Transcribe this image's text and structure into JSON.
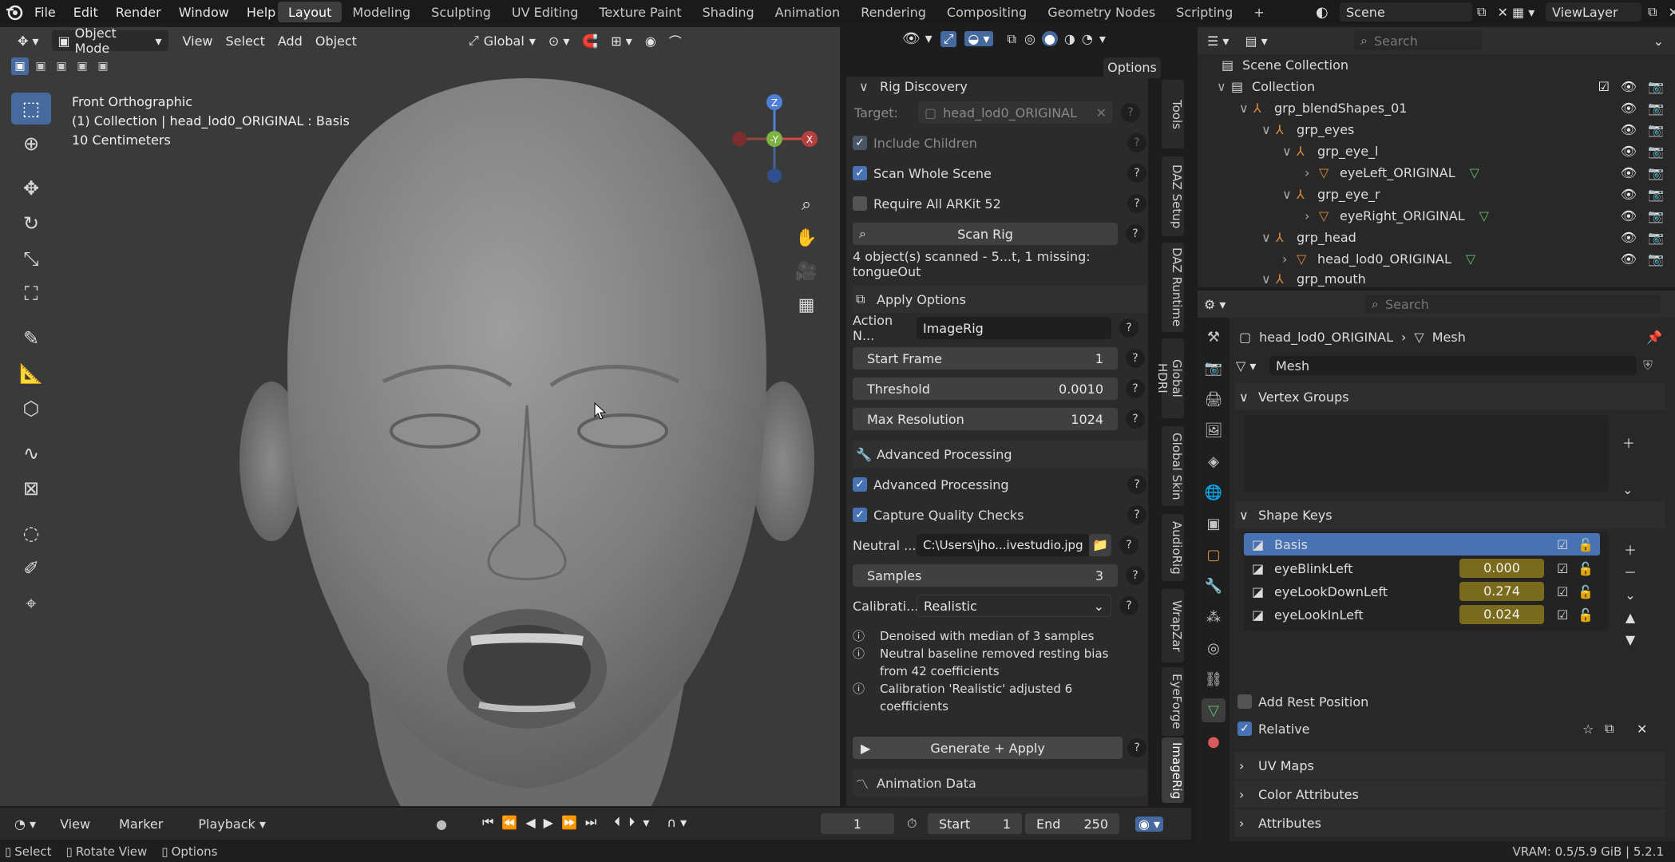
{
  "topbar": {
    "menus": [
      "File",
      "Edit",
      "Render",
      "Window",
      "Help"
    ],
    "workspaces": [
      "Layout",
      "Modeling",
      "Sculpting",
      "UV Editing",
      "Texture Paint",
      "Shading",
      "Animation",
      "Rendering",
      "Compositing",
      "Geometry Nodes",
      "Scripting"
    ],
    "active_workspace": "Layout",
    "add_tab": "+",
    "scene": "Scene",
    "view_layer": "ViewLayer"
  },
  "viewport": {
    "mode": "Object Mode",
    "menus": [
      "View",
      "Select",
      "Add",
      "Object"
    ],
    "transform": "Global",
    "options": "Options",
    "overlay_title": "Front Orthographic",
    "overlay_line2": "(1) Collection | head_lod0_ORIGINAL : Basis",
    "overlay_line3": "10 Centimeters",
    "gizmo": {
      "z": "Z",
      "y": "-Y",
      "x": "X"
    }
  },
  "npanel": {
    "rig_discovery": "Rig Discovery",
    "target_label": "Target:",
    "target_value": "head_lod0_ORIGINAL",
    "include_children": "Include Children",
    "scan_whole_scene": "Scan Whole Scene",
    "require_arkit": "Require All ARKit 52",
    "scan_rig": "Scan Rig",
    "scan_status": "4 object(s) scanned - 5...t, 1 missing: tongueOut",
    "apply_options": "Apply Options",
    "action_label": "Action N...",
    "action_value": "ImageRig",
    "start_frame_label": "Start Frame",
    "start_frame_value": "1",
    "threshold_label": "Threshold",
    "threshold_value": "0.0010",
    "max_res_label": "Max Resolution",
    "max_res_value": "1024",
    "advanced_header": "Advanced Processing",
    "advanced_processing": "Advanced Processing",
    "capture_quality": "Capture Quality Checks",
    "neutral_label": "Neutral ...",
    "neutral_value": "C:\\Users\\jho...ivestudio.jpg",
    "samples_label": "Samples",
    "samples_value": "3",
    "calib_label": "Calibrati...",
    "calib_value": "Realistic",
    "info1": "Denoised with median of 3 samples",
    "info2a": "Neutral baseline removed resting bias",
    "info2b": "from 42 coefficients",
    "info3a": "Calibration 'Realistic' adjusted 6",
    "info3b": "coefficients",
    "generate": "Generate + Apply",
    "animation_data": "Animation Data",
    "vtabs": [
      "Tools",
      "DAZ Setup",
      "DAZ Runtime",
      "Global HDRI",
      "Global Skin",
      "AudioRig",
      "WrapZar",
      "EyeForge",
      "ImageRig"
    ]
  },
  "outliner": {
    "search_placeholder": "Search",
    "rows": [
      {
        "label": "Scene Collection",
        "indent": 0
      },
      {
        "label": "Collection",
        "indent": 1
      },
      {
        "label": "grp_blendShapes_01",
        "indent": 2
      },
      {
        "label": "grp_eyes",
        "indent": 3
      },
      {
        "label": "grp_eye_l",
        "indent": 4
      },
      {
        "label": "eyeLeft_ORIGINAL",
        "indent": 5
      },
      {
        "label": "grp_eye_r",
        "indent": 4
      },
      {
        "label": "eyeRight_ORIGINAL",
        "indent": 5
      },
      {
        "label": "grp_head",
        "indent": 3
      },
      {
        "label": "head_lod0_ORIGINAL",
        "indent": 4
      },
      {
        "label": "grp_mouth",
        "indent": 3
      }
    ]
  },
  "properties": {
    "search_placeholder": "Search",
    "breadcrumb_object": "head_lod0_ORIGINAL",
    "breadcrumb_data": "Mesh",
    "mesh_name": "Mesh",
    "vertex_groups": "Vertex Groups",
    "shape_keys": "Shape Keys",
    "keys": [
      {
        "name": "Basis",
        "value": ""
      },
      {
        "name": "eyeBlinkLeft",
        "value": "0.000"
      },
      {
        "name": "eyeLookDownLeft",
        "value": "0.274"
      },
      {
        "name": "eyeLookInLeft",
        "value": "0.024"
      }
    ],
    "add_rest_position": "Add Rest Position",
    "relative": "Relative",
    "uv_maps": "UV Maps",
    "color_attributes": "Color Attributes",
    "attributes": "Attributes"
  },
  "timeline": {
    "menus": [
      "View",
      "Marker",
      "Playback"
    ],
    "current_frame": "1",
    "start_label": "Start",
    "start_value": "1",
    "end_label": "End",
    "end_value": "250"
  },
  "statusbar": {
    "select": "Select",
    "rotate": "Rotate View",
    "options": "Options",
    "vram": "VRAM: 0.5/5.9 GiB | 5.2.1"
  }
}
